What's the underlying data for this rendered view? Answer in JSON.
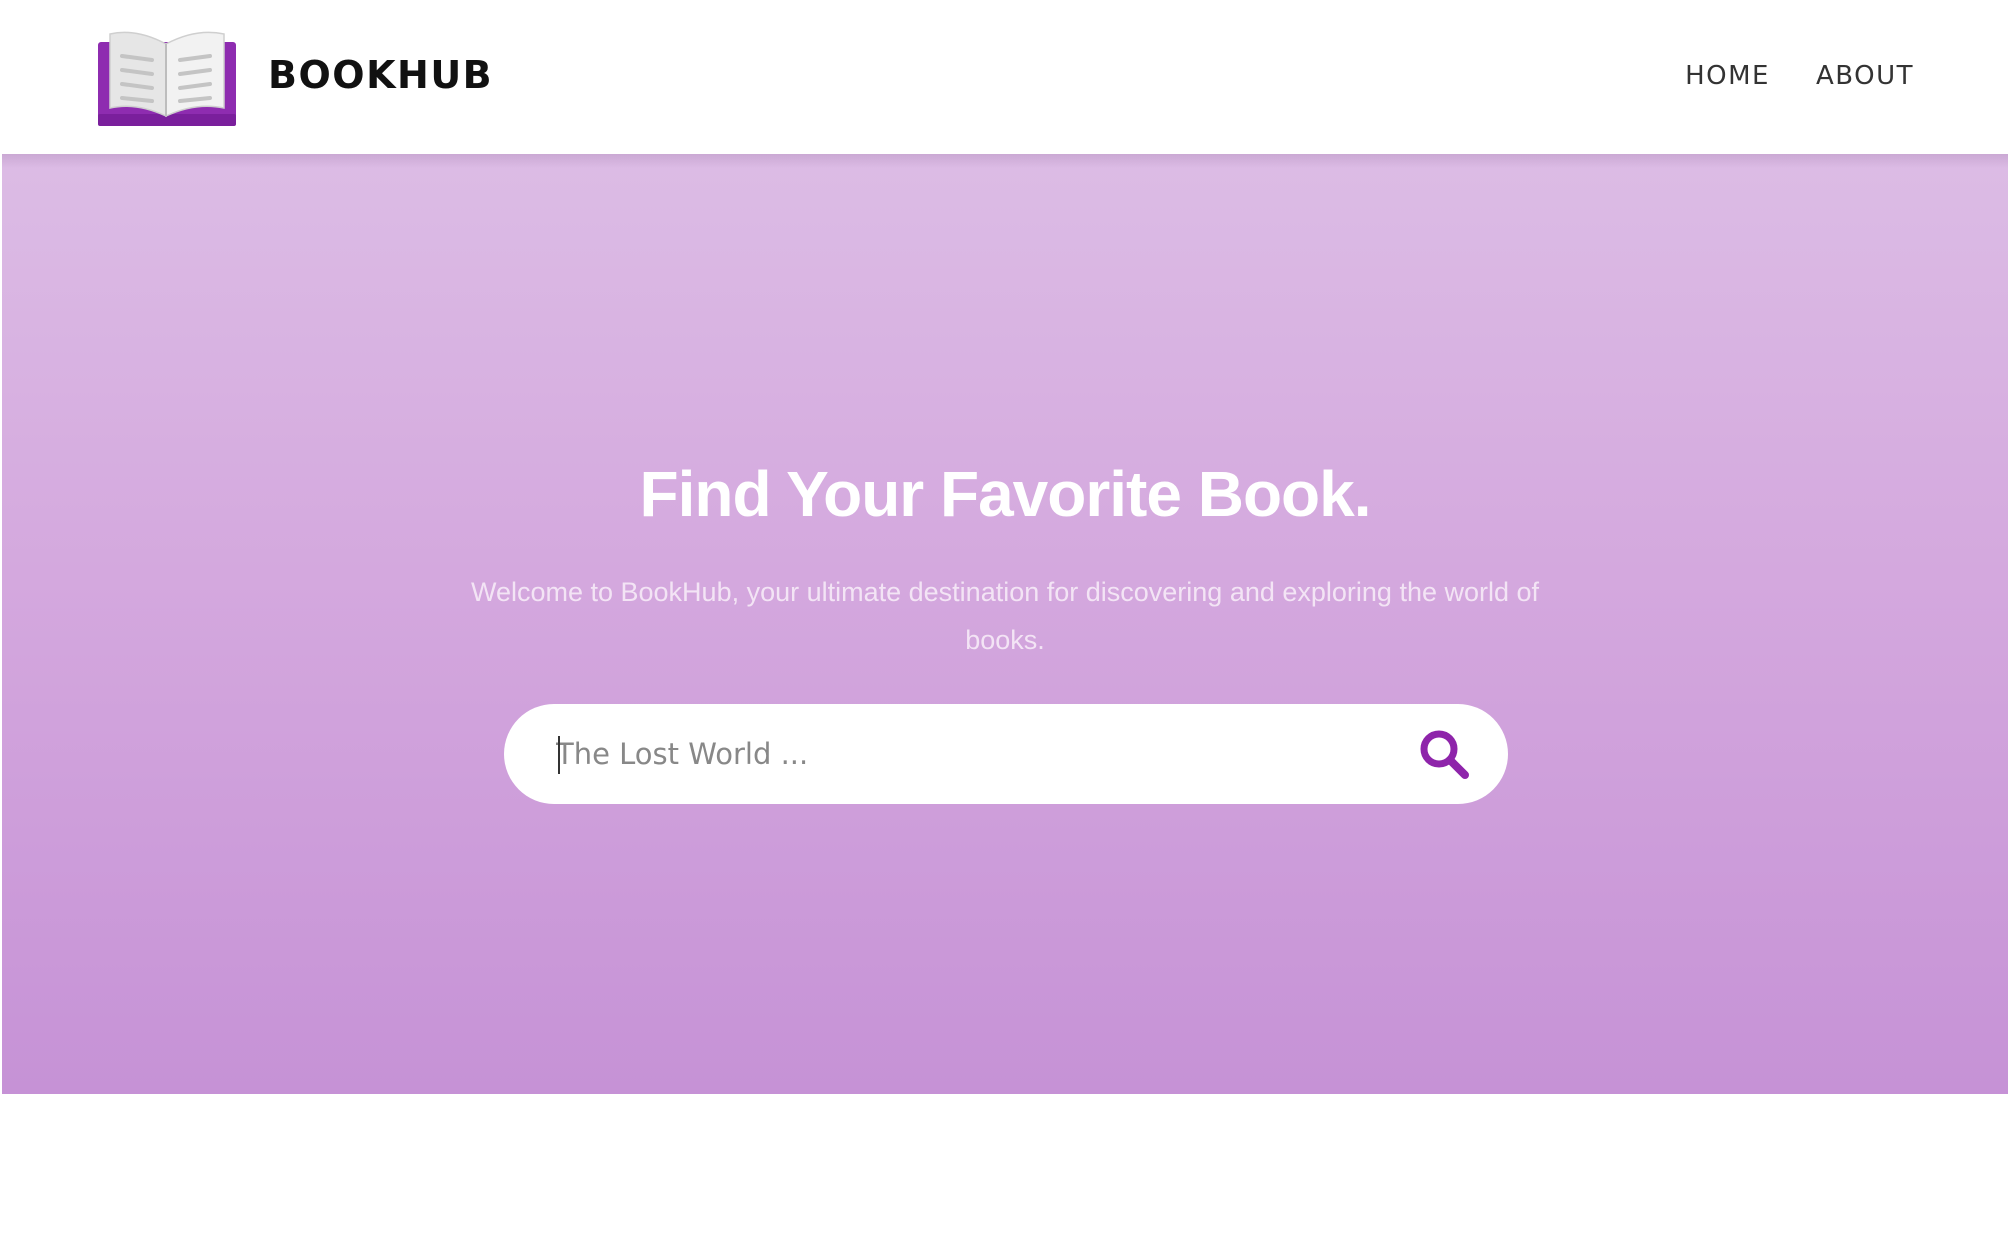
{
  "header": {
    "brand": "BOOKHUB",
    "logo_icon": "open-book-icon",
    "nav": {
      "home": "HOME",
      "about": "ABOUT"
    }
  },
  "hero": {
    "title": "Find Your Favorite Book.",
    "subtitle": "Welcome to BookHub, your ultimate destination for discovering and exploring the world of books.",
    "search": {
      "placeholder": "The Lost World ...",
      "value": "",
      "icon": "search-icon"
    }
  },
  "colors": {
    "accent": "#8e24aa",
    "hero_top": "#dcbce5",
    "hero_bottom": "#c692d6",
    "text_dark": "#111111"
  }
}
